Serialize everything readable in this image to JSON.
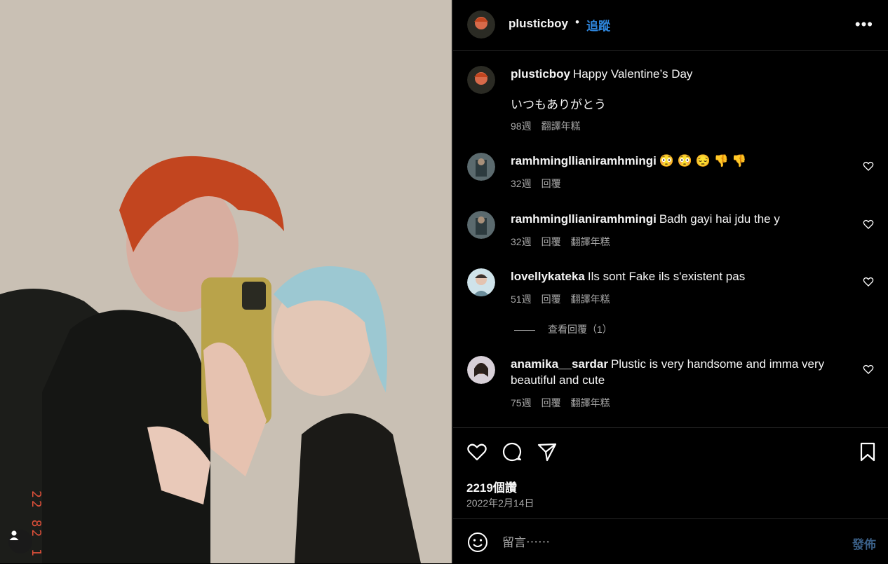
{
  "header": {
    "username": "plusticboy",
    "separator": "•",
    "follow_label": "追蹤",
    "more_icon": "more-horizontal-icon"
  },
  "caption": {
    "username": "plusticboy",
    "text_line1": "Happy Valentine’s Day",
    "text_line2": "いつもありがとう",
    "age": "98週",
    "translate": "翻譯年糕"
  },
  "comments": [
    {
      "username": "ramhmingllianiramhmingi",
      "text": "😳 😳 😔 👎 👎",
      "age": "32週",
      "reply": "回覆",
      "translate": ""
    },
    {
      "username": "ramhmingllianiramhmingi",
      "text": "Badh gayi hai jdu the y",
      "age": "32週",
      "reply": "回覆",
      "translate": "翻譯年糕"
    },
    {
      "username": "lovellykateka",
      "text": "Ils sont Fake ils s'existent pas",
      "age": "51週",
      "reply": "回覆",
      "translate": "翻譯年糕",
      "view_replies": "查看回覆（1）"
    },
    {
      "username": "anamika__sardar",
      "text": "Plustic is very handsome and imma very beautiful and cute",
      "age": "75週",
      "reply": "回覆",
      "translate": "翻譯年糕"
    }
  ],
  "actions": {
    "likes": "2219個讚",
    "date": "2022年2月14日"
  },
  "composer": {
    "placeholder": "留言⋯⋯",
    "post_label": "發佈"
  },
  "photo": {
    "timestamp_text": "22 82 1"
  },
  "colors": {
    "accent": "#2e86de",
    "muted": "#a8a8a8",
    "post_disabled": "#3a5f86"
  }
}
